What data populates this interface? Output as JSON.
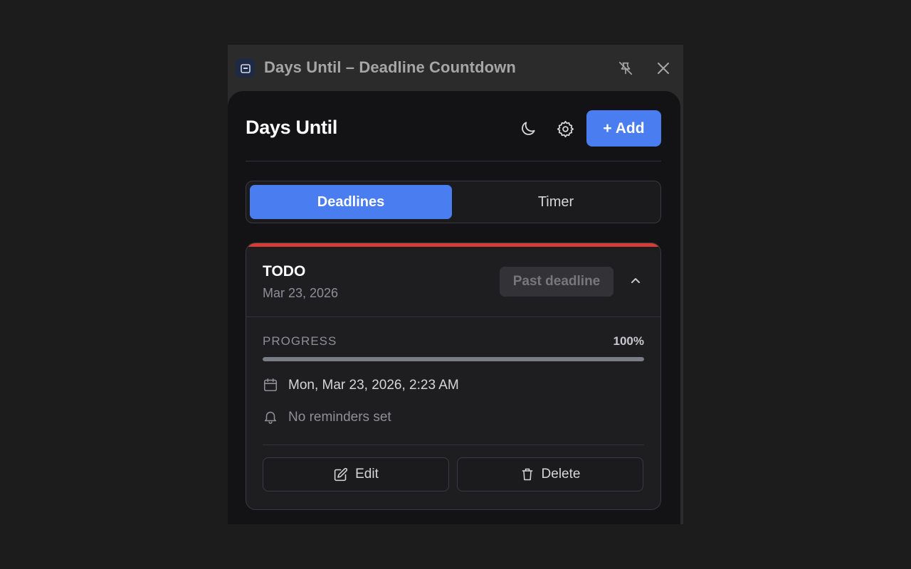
{
  "window": {
    "title": "Days Until – Deadline Countdown",
    "icons": {
      "app": "app-icon",
      "unpin": "unpin-icon",
      "close": "close-icon"
    }
  },
  "header": {
    "title": "Days Until",
    "theme_icon": "moon-icon",
    "settings_icon": "gear-icon",
    "add_label": "+ Add"
  },
  "tabs": [
    {
      "label": "Deadlines",
      "active": true
    },
    {
      "label": "Timer",
      "active": false
    }
  ],
  "deadline": {
    "title": "TODO",
    "date_short": "Mar 23, 2026",
    "status": "Past deadline",
    "progress_label": "PROGRESS",
    "progress_text": "100%",
    "progress_fraction": 1.0,
    "due_datetime": "Mon, Mar 23, 2026, 2:23 AM",
    "reminders": "No reminders set",
    "edit_label": "Edit",
    "delete_label": "Delete"
  },
  "colors": {
    "accent": "#4a7ef0",
    "past_due": "#d63c34",
    "background": "#131315"
  }
}
